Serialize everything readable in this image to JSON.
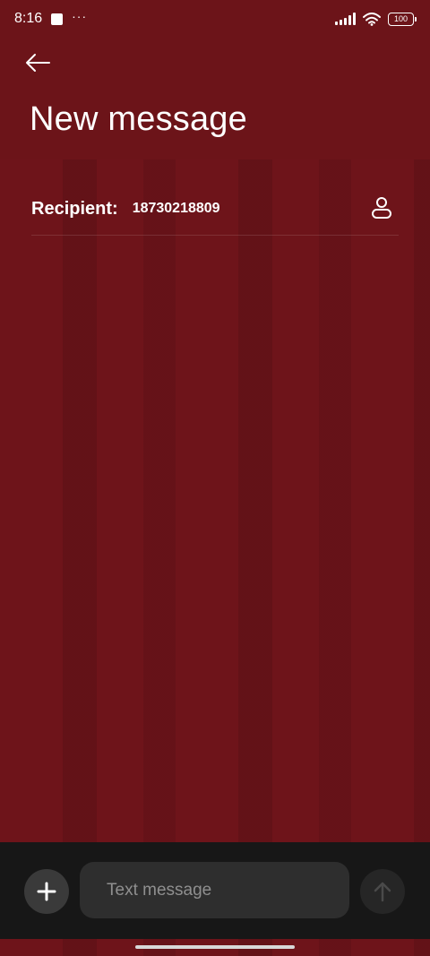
{
  "status_bar": {
    "time": "8:16",
    "overflow": "···",
    "battery": "100",
    "icons": [
      "notification-square-icon",
      "signal-icon",
      "wifi-icon",
      "battery-icon"
    ]
  },
  "header": {
    "back_icon": "arrow-left-icon",
    "title": "New message"
  },
  "recipient": {
    "label": "Recipient:",
    "value": "18730218809",
    "contact_icon": "person-icon"
  },
  "composer": {
    "add_icon": "plus-icon",
    "placeholder": "Text message",
    "send_icon": "arrow-up-icon"
  },
  "colors": {
    "background": "#6e141a",
    "composer": "#171717",
    "input": "#2e2e2e"
  }
}
